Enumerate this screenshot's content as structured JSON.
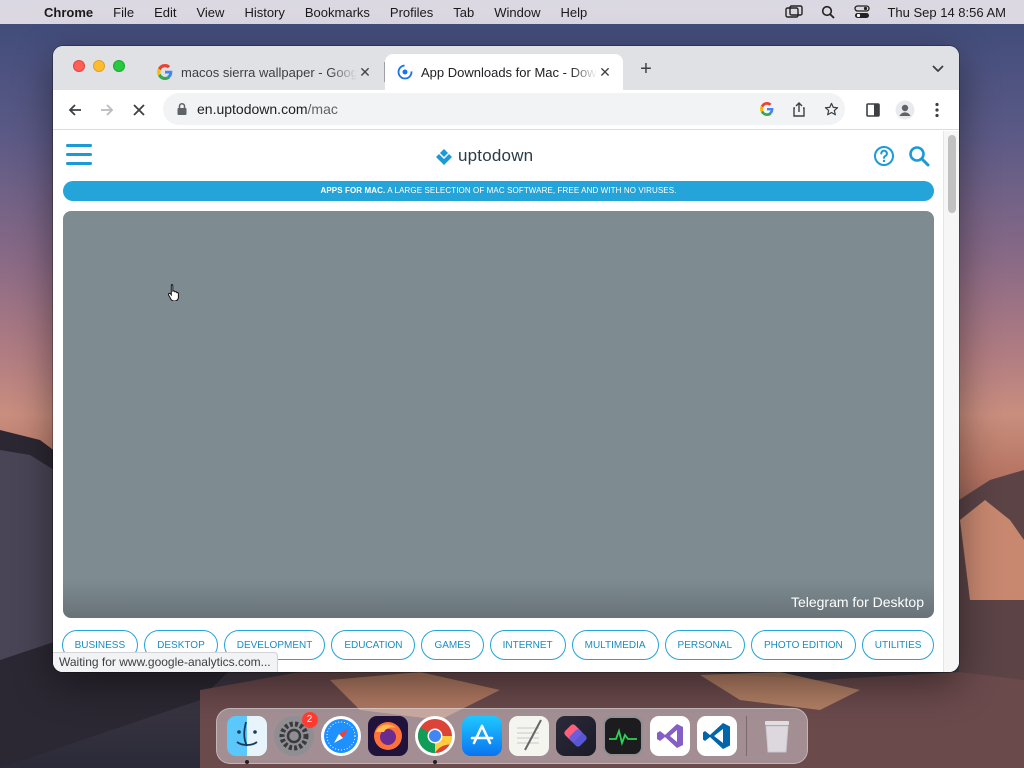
{
  "menubar": {
    "app_name": "Chrome",
    "items": [
      "File",
      "Edit",
      "View",
      "History",
      "Bookmarks",
      "Profiles",
      "Tab",
      "Window",
      "Help"
    ],
    "clock": "Thu Sep 14  8:56 AM"
  },
  "browser": {
    "tabs": [
      {
        "title": "macos sierra wallpaper - Google Search",
        "favicon": "google-icon",
        "active": false
      },
      {
        "title": "App Downloads for Mac - Download",
        "favicon": "uptodown-icon",
        "active": true
      }
    ],
    "url_host": "en.uptodown.com",
    "url_path": "/mac",
    "status_text": "Waiting for www.google-analytics.com..."
  },
  "page": {
    "logo_text": "uptodown",
    "banner_bold": "APPS FOR MAC.",
    "banner_text": " A LARGE SELECTION OF MAC SOFTWARE, FREE AND WITH NO VIRUSES.",
    "hero_caption": "Telegram for Desktop",
    "categories": [
      "BUSINESS",
      "DESKTOP",
      "DEVELOPMENT",
      "EDUCATION",
      "GAMES",
      "INTERNET",
      "MULTIMEDIA",
      "PERSONAL",
      "PHOTO EDITION",
      "UTILITIES"
    ]
  },
  "dock": {
    "apps": [
      "Finder",
      "System Preferences",
      "Safari",
      "Firefox",
      "Google Chrome",
      "App Store",
      "TextEdit",
      "Shortcuts",
      "Activity Monitor",
      "Visual Studio",
      "Visual Studio Code",
      "Trash"
    ],
    "settings_badge": "2"
  },
  "colors": {
    "accent": "#24a4d8",
    "hero_bg": "#7e8c92"
  }
}
